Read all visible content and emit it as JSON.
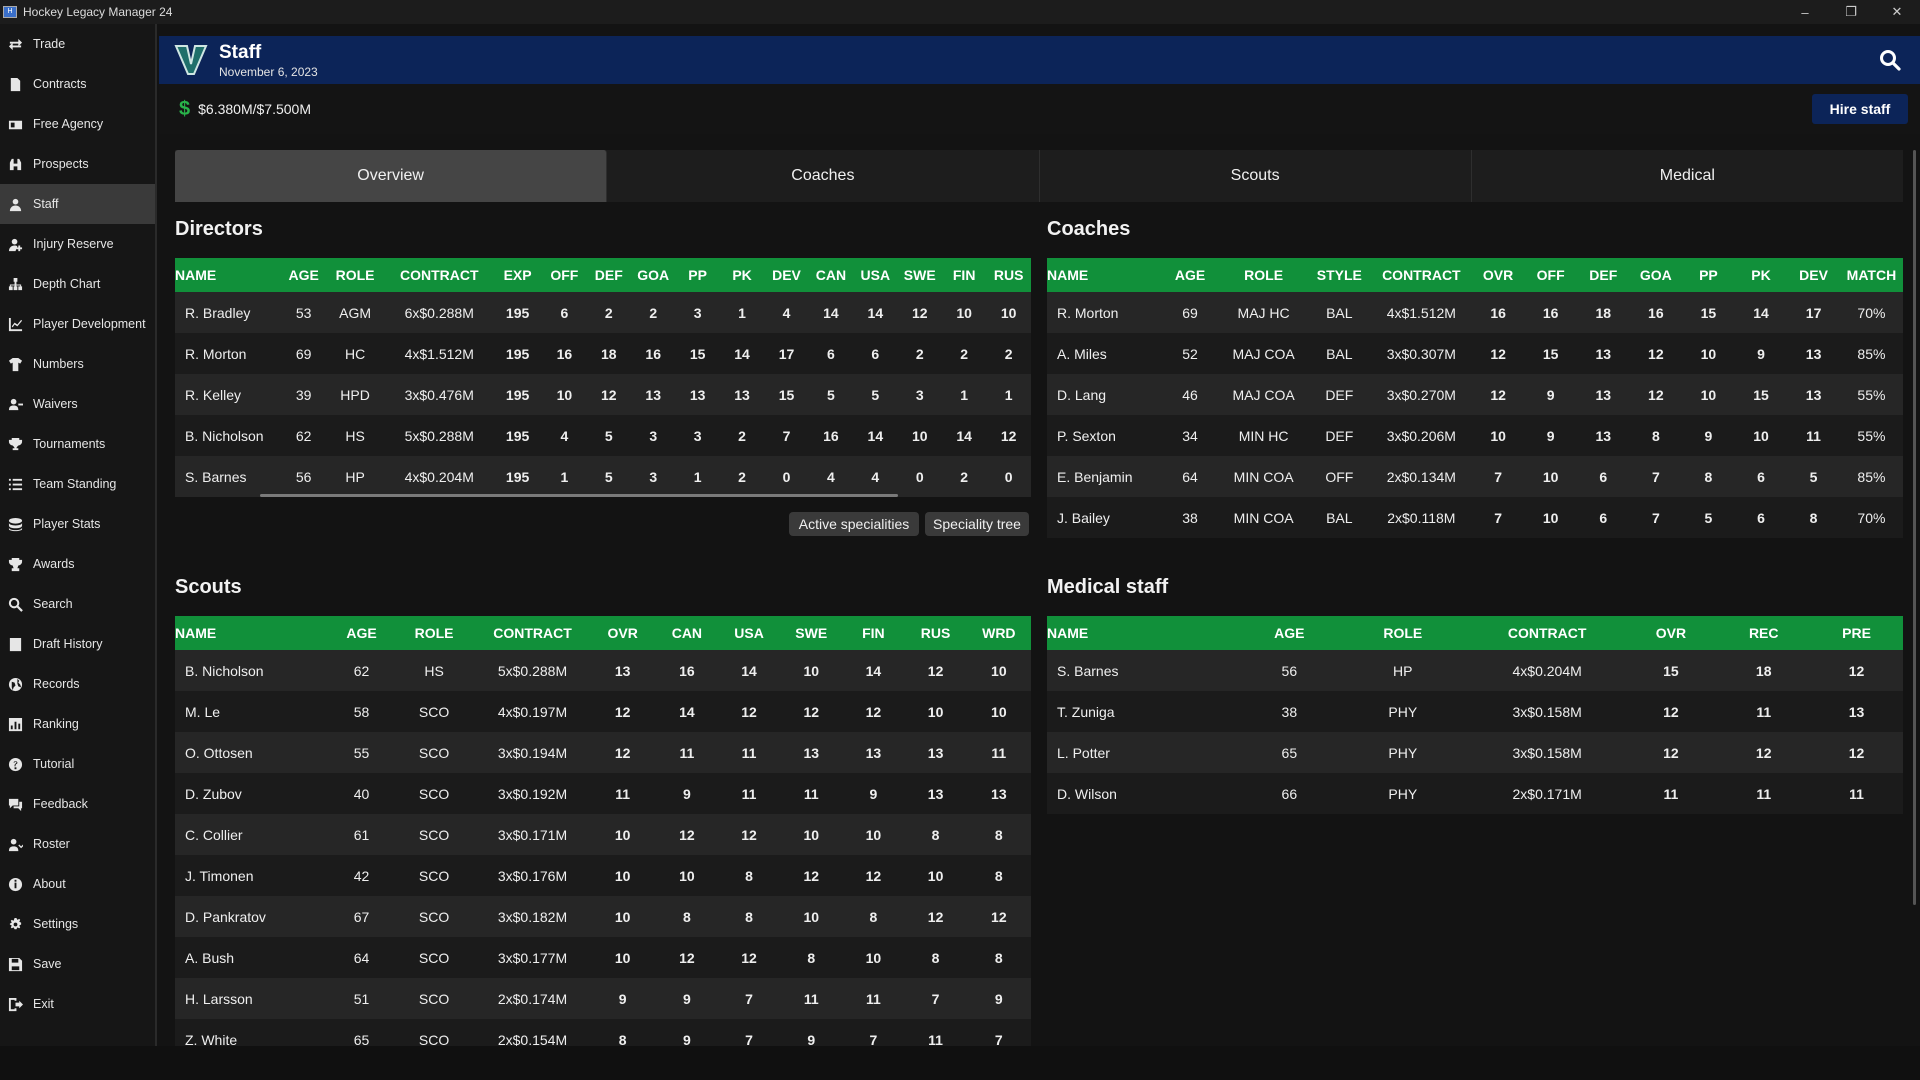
{
  "window": {
    "title": "Hockey Legacy Manager 24",
    "minimize": "–",
    "restore": "❐",
    "close": "✕"
  },
  "sidebar": {
    "items": [
      {
        "label": "Trade",
        "icon": "trade-icon"
      },
      {
        "label": "Contracts",
        "icon": "contract-icon"
      },
      {
        "label": "Free Agency",
        "icon": "free-agency-icon"
      },
      {
        "label": "Prospects",
        "icon": "binoculars-icon"
      },
      {
        "label": "Staff",
        "icon": "staff-icon",
        "active": true
      },
      {
        "label": "Injury Reserve",
        "icon": "injury-icon"
      },
      {
        "label": "Depth Chart",
        "icon": "depth-chart-icon"
      },
      {
        "label": "Player Development",
        "icon": "chart-icon"
      },
      {
        "label": "Numbers",
        "icon": "jersey-icon"
      },
      {
        "label": "Waivers",
        "icon": "waivers-icon"
      },
      {
        "label": "Tournaments",
        "icon": "trophy-icon"
      },
      {
        "label": "Team Standing",
        "icon": "list-icon"
      },
      {
        "label": "Player Stats",
        "icon": "stats-icon"
      },
      {
        "label": "Awards",
        "icon": "award-icon"
      },
      {
        "label": "Search",
        "icon": "search-icon"
      },
      {
        "label": "Draft History",
        "icon": "draft-icon"
      },
      {
        "label": "Records",
        "icon": "globe-icon"
      },
      {
        "label": "Ranking",
        "icon": "ranking-icon"
      },
      {
        "label": "Tutorial",
        "icon": "help-icon"
      },
      {
        "label": "Feedback",
        "icon": "feedback-icon"
      },
      {
        "label": "Roster",
        "icon": "roster-icon"
      },
      {
        "label": "About",
        "icon": "info-icon"
      },
      {
        "label": "Settings",
        "icon": "gear-icon"
      },
      {
        "label": "Save",
        "icon": "save-icon"
      },
      {
        "label": "Exit",
        "icon": "exit-icon"
      }
    ]
  },
  "header": {
    "title": "Staff",
    "date": "November 6, 2023"
  },
  "budget": {
    "symbol": "$",
    "text": "$6.380M/$7.500M",
    "hire_label": "Hire staff"
  },
  "tabs": [
    "Overview",
    "Coaches",
    "Scouts",
    "Medical"
  ],
  "directors": {
    "title": "Directors",
    "columns": [
      "NAME",
      "AGE",
      "ROLE",
      "CONTRACT",
      "EXP",
      "OFF",
      "DEF",
      "GOA",
      "PP",
      "PK",
      "DEV",
      "CAN",
      "USA",
      "SWE",
      "FIN",
      "RUS"
    ],
    "rows": [
      [
        "R. Bradley",
        "53",
        "AGM",
        "6x$0.288M",
        "195",
        "6",
        "2",
        "2",
        "3",
        "1",
        "4",
        "14",
        "14",
        "12",
        "10",
        "10"
      ],
      [
        "R. Morton",
        "69",
        "HC",
        "4x$1.512M",
        "195",
        "16",
        "18",
        "16",
        "15",
        "14",
        "17",
        "6",
        "6",
        "2",
        "2",
        "2"
      ],
      [
        "R. Kelley",
        "39",
        "HPD",
        "3x$0.476M",
        "195",
        "10",
        "12",
        "13",
        "13",
        "13",
        "15",
        "5",
        "5",
        "3",
        "1",
        "1"
      ],
      [
        "B. Nicholson",
        "62",
        "HS",
        "5x$0.288M",
        "195",
        "4",
        "5",
        "3",
        "3",
        "2",
        "7",
        "16",
        "14",
        "10",
        "14",
        "12"
      ],
      [
        "S. Barnes",
        "56",
        "HP",
        "4x$0.204M",
        "195",
        "1",
        "5",
        "3",
        "1",
        "2",
        "0",
        "4",
        "4",
        "0",
        "2",
        "0"
      ]
    ],
    "colors": [
      [
        "",
        "",
        "",
        "",
        "g",
        "r",
        "r",
        "r",
        "r",
        "r",
        "r",
        "g",
        "g",
        "y",
        "y",
        "y"
      ],
      [
        "",
        "",
        "",
        "",
        "g",
        "g",
        "b",
        "g",
        "g",
        "g",
        "g",
        "r",
        "r",
        "r",
        "r",
        "r"
      ],
      [
        "",
        "",
        "",
        "",
        "g",
        "y",
        "lg",
        "g",
        "g",
        "g",
        "g",
        "r",
        "r",
        "r",
        "r",
        "r"
      ],
      [
        "",
        "",
        "",
        "",
        "g",
        "r",
        "r",
        "r",
        "r",
        "r",
        "r",
        "g",
        "g",
        "y",
        "g",
        "lg"
      ],
      [
        "",
        "",
        "",
        "",
        "g",
        "r",
        "r",
        "r",
        "r",
        "r",
        "r",
        "r",
        "r",
        "r",
        "r",
        "r"
      ]
    ],
    "buttons": {
      "active_specialities": "Active specialities",
      "speciality_tree": "Speciality tree"
    }
  },
  "coaches": {
    "title": "Coaches",
    "columns": [
      "NAME",
      "AGE",
      "ROLE",
      "STYLE",
      "CONTRACT",
      "OVR",
      "OFF",
      "DEF",
      "GOA",
      "PP",
      "PK",
      "DEV",
      "MATCH"
    ],
    "rows": [
      [
        "R. Morton",
        "69",
        "MAJ HC",
        "BAL",
        "4x$1.512M",
        "16",
        "16",
        "18",
        "16",
        "15",
        "14",
        "17",
        "70%"
      ],
      [
        "A. Miles",
        "52",
        "MAJ COA",
        "BAL",
        "3x$0.307M",
        "12",
        "15",
        "13",
        "12",
        "10",
        "9",
        "13",
        "85%"
      ],
      [
        "D. Lang",
        "46",
        "MAJ COA",
        "DEF",
        "3x$0.270M",
        "12",
        "9",
        "13",
        "12",
        "10",
        "15",
        "13",
        "55%"
      ],
      [
        "P. Sexton",
        "34",
        "MIN HC",
        "DEF",
        "3x$0.206M",
        "10",
        "9",
        "13",
        "8",
        "9",
        "10",
        "11",
        "55%"
      ],
      [
        "E. Benjamin",
        "64",
        "MIN COA",
        "OFF",
        "2x$0.134M",
        "7",
        "10",
        "6",
        "7",
        "8",
        "6",
        "5",
        "85%"
      ],
      [
        "J. Bailey",
        "38",
        "MIN COA",
        "BAL",
        "2x$0.118M",
        "7",
        "10",
        "6",
        "7",
        "5",
        "6",
        "8",
        "70%"
      ]
    ],
    "colors": [
      [
        "",
        "",
        "",
        "",
        "",
        "g",
        "g",
        "b",
        "g",
        "g",
        "g",
        "g",
        ""
      ],
      [
        "",
        "",
        "",
        "",
        "",
        "lg",
        "g",
        "g",
        "lg",
        "y",
        "o",
        "g",
        ""
      ],
      [
        "",
        "",
        "",
        "",
        "",
        "lg",
        "o",
        "g",
        "lg",
        "y",
        "g",
        "g",
        ""
      ],
      [
        "",
        "",
        "",
        "",
        "",
        "y",
        "o",
        "g",
        "o",
        "o",
        "y",
        "lg",
        ""
      ],
      [
        "",
        "",
        "",
        "",
        "",
        "r",
        "y",
        "r",
        "r",
        "o",
        "r",
        "r",
        ""
      ],
      [
        "",
        "",
        "",
        "",
        "",
        "r",
        "y",
        "r",
        "r",
        "r",
        "r",
        "o",
        ""
      ]
    ]
  },
  "scouts": {
    "title": "Scouts",
    "columns": [
      "NAME",
      "AGE",
      "ROLE",
      "CONTRACT",
      "OVR",
      "CAN",
      "USA",
      "SWE",
      "FIN",
      "RUS",
      "WRD"
    ],
    "rows": [
      [
        "B. Nicholson",
        "62",
        "HS",
        "5x$0.288M",
        "13",
        "16",
        "14",
        "10",
        "14",
        "12",
        "10"
      ],
      [
        "M. Le",
        "58",
        "SCO",
        "4x$0.197M",
        "12",
        "14",
        "12",
        "12",
        "12",
        "10",
        "10"
      ],
      [
        "O. Ottosen",
        "55",
        "SCO",
        "3x$0.194M",
        "12",
        "11",
        "11",
        "13",
        "13",
        "13",
        "11"
      ],
      [
        "D. Zubov",
        "40",
        "SCO",
        "3x$0.192M",
        "11",
        "9",
        "11",
        "11",
        "9",
        "13",
        "13"
      ],
      [
        "C. Collier",
        "61",
        "SCO",
        "3x$0.171M",
        "10",
        "12",
        "12",
        "10",
        "10",
        "8",
        "8"
      ],
      [
        "J. Timonen",
        "42",
        "SCO",
        "3x$0.176M",
        "10",
        "10",
        "8",
        "12",
        "12",
        "10",
        "8"
      ],
      [
        "D. Pankratov",
        "67",
        "SCO",
        "3x$0.182M",
        "10",
        "8",
        "8",
        "10",
        "8",
        "12",
        "12"
      ],
      [
        "A. Bush",
        "64",
        "SCO",
        "3x$0.177M",
        "10",
        "12",
        "12",
        "8",
        "10",
        "8",
        "8"
      ],
      [
        "H. Larsson",
        "51",
        "SCO",
        "2x$0.174M",
        "9",
        "9",
        "7",
        "11",
        "11",
        "7",
        "9"
      ],
      [
        "Z. White",
        "65",
        "SCO",
        "2x$0.154M",
        "8",
        "9",
        "7",
        "9",
        "7",
        "11",
        "7"
      ]
    ],
    "colors": [
      [
        "",
        "",
        "",
        "",
        "g",
        "g",
        "g",
        "y",
        "g",
        "lg",
        "y"
      ],
      [
        "",
        "",
        "",
        "",
        "lg",
        "g",
        "lg",
        "lg",
        "lg",
        "y",
        "y"
      ],
      [
        "",
        "",
        "",
        "",
        "lg",
        "lg",
        "lg",
        "g",
        "g",
        "g",
        "lg"
      ],
      [
        "",
        "",
        "",
        "",
        "lg",
        "o",
        "lg",
        "lg",
        "o",
        "g",
        "g"
      ],
      [
        "",
        "",
        "",
        "",
        "y",
        "lg",
        "lg",
        "y",
        "y",
        "o",
        "o"
      ],
      [
        "",
        "",
        "",
        "",
        "y",
        "y",
        "o",
        "lg",
        "lg",
        "y",
        "o"
      ],
      [
        "",
        "",
        "",
        "",
        "y",
        "o",
        "o",
        "y",
        "o",
        "lg",
        "lg"
      ],
      [
        "",
        "",
        "",
        "",
        "y",
        "lg",
        "lg",
        "o",
        "y",
        "o",
        "o"
      ],
      [
        "",
        "",
        "",
        "",
        "o",
        "o",
        "o",
        "lg",
        "lg",
        "o",
        "o"
      ],
      [
        "",
        "",
        "",
        "",
        "o",
        "o",
        "o",
        "o",
        "o",
        "lg",
        "o"
      ]
    ]
  },
  "medical": {
    "title": "Medical staff",
    "columns": [
      "NAME",
      "AGE",
      "ROLE",
      "CONTRACT",
      "OVR",
      "REC",
      "PRE"
    ],
    "rows": [
      [
        "S. Barnes",
        "56",
        "HP",
        "4x$0.204M",
        "15",
        "18",
        "12"
      ],
      [
        "T. Zuniga",
        "38",
        "PHY",
        "3x$0.158M",
        "12",
        "11",
        "13"
      ],
      [
        "L. Potter",
        "65",
        "PHY",
        "3x$0.158M",
        "12",
        "12",
        "12"
      ],
      [
        "D. Wilson",
        "66",
        "PHY",
        "2x$0.171M",
        "11",
        "11",
        "11"
      ]
    ],
    "colors": [
      [
        "",
        "",
        "",
        "",
        "g",
        "b",
        "lg"
      ],
      [
        "",
        "",
        "",
        "",
        "lg",
        "lg",
        "g"
      ],
      [
        "",
        "",
        "",
        "",
        "lg",
        "lg",
        "lg"
      ],
      [
        "",
        "",
        "",
        "",
        "lg",
        "lg",
        "lg"
      ]
    ]
  }
}
